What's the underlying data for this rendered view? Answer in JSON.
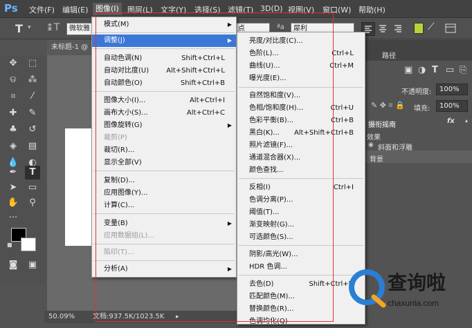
{
  "app": {
    "logo": "Ps"
  },
  "menubar": {
    "items": [
      "文件(F)",
      "编辑(E)",
      "图像(I)",
      "图层(L)",
      "文字(Y)",
      "选择(S)",
      "滤镜(T)",
      "3D(D)",
      "视图(V)",
      "窗口(W)",
      "帮助(H)"
    ]
  },
  "options": {
    "font_family": "微软雅",
    "font_size": "点",
    "aa_mode": "犀利"
  },
  "document": {
    "tab_title": "未标题-1 @",
    "zoom": "50.09%",
    "doc_info": "文档:937.5K/1023.5K"
  },
  "panels": {
    "tab": "路径",
    "opacity_label": "不透明度:",
    "opacity_value": "100%",
    "fill_label": "填充:",
    "fill_value": "100%",
    "fx": "fx",
    "layer_name": "摄衔摇南",
    "effects_label": "效果",
    "effect_item": "斜面和浮雕",
    "bg_layer": "背景"
  },
  "image_menu": {
    "items": [
      {
        "label": "模式(M)",
        "shortcut": "",
        "submenu": true
      },
      {
        "label": "调整(J)",
        "shortcut": "",
        "submenu": true,
        "highlighted": true
      },
      {
        "label": "自动色调(N)",
        "shortcut": "Shift+Ctrl+L"
      },
      {
        "label": "自动对比度(U)",
        "shortcut": "Alt+Shift+Ctrl+L"
      },
      {
        "label": "自动颜色(O)",
        "shortcut": "Shift+Ctrl+B"
      },
      {
        "label": "图像大小(I)...",
        "shortcut": "Alt+Ctrl+I"
      },
      {
        "label": "画布大小(S)...",
        "shortcut": "Alt+Ctrl+C"
      },
      {
        "label": "图像旋转(G)",
        "shortcut": "",
        "submenu": true
      },
      {
        "label": "裁剪(P)",
        "shortcut": "",
        "disabled": true
      },
      {
        "label": "裁切(R)...",
        "shortcut": ""
      },
      {
        "label": "显示全部(V)",
        "shortcut": ""
      },
      {
        "label": "复制(D)...",
        "shortcut": ""
      },
      {
        "label": "应用图像(Y)...",
        "shortcut": ""
      },
      {
        "label": "计算(C)...",
        "shortcut": ""
      },
      {
        "label": "变量(B)",
        "shortcut": "",
        "submenu": true
      },
      {
        "label": "应用数据组(L)...",
        "shortcut": "",
        "disabled": true
      },
      {
        "label": "陷印(T)...",
        "shortcut": "",
        "disabled": true
      },
      {
        "label": "分析(A)",
        "shortcut": "",
        "submenu": true
      }
    ]
  },
  "adjust_menu": {
    "items": [
      {
        "label": "亮度/对比度(C)...",
        "shortcut": ""
      },
      {
        "label": "色阶(L)...",
        "shortcut": "Ctrl+L"
      },
      {
        "label": "曲线(U)...",
        "shortcut": "Ctrl+M"
      },
      {
        "label": "曝光度(E)...",
        "shortcut": ""
      },
      {
        "label": "自然饱和度(V)...",
        "shortcut": ""
      },
      {
        "label": "色相/饱和度(H)...",
        "shortcut": "Ctrl+U"
      },
      {
        "label": "色彩平衡(B)...",
        "shortcut": "Ctrl+B"
      },
      {
        "label": "黑白(K)...",
        "shortcut": "Alt+Shift+Ctrl+B"
      },
      {
        "label": "照片滤镜(F)...",
        "shortcut": ""
      },
      {
        "label": "通道混合器(X)...",
        "shortcut": ""
      },
      {
        "label": "颜色查找...",
        "shortcut": ""
      },
      {
        "label": "反相(I)",
        "shortcut": "Ctrl+I"
      },
      {
        "label": "色调分离(P)...",
        "shortcut": ""
      },
      {
        "label": "阈值(T)...",
        "shortcut": ""
      },
      {
        "label": "渐变映射(G)...",
        "shortcut": ""
      },
      {
        "label": "可选颜色(S)...",
        "shortcut": ""
      },
      {
        "label": "阴影/高光(W)...",
        "shortcut": ""
      },
      {
        "label": "HDR 色调...",
        "shortcut": ""
      },
      {
        "label": "去色(D)",
        "shortcut": "Shift+Ctrl+U"
      },
      {
        "label": "匹配颜色(M)...",
        "shortcut": ""
      },
      {
        "label": "替换颜色(R)...",
        "shortcut": ""
      },
      {
        "label": "色调均化(Q)",
        "shortcut": ""
      }
    ]
  },
  "watermark": {
    "brand": "查询啦",
    "url": "chaxunla.com"
  },
  "colors": {
    "menu_highlight": "#3b77d6",
    "annotation_red": "#e53030",
    "watermark_blue": "#2a7fd4"
  }
}
